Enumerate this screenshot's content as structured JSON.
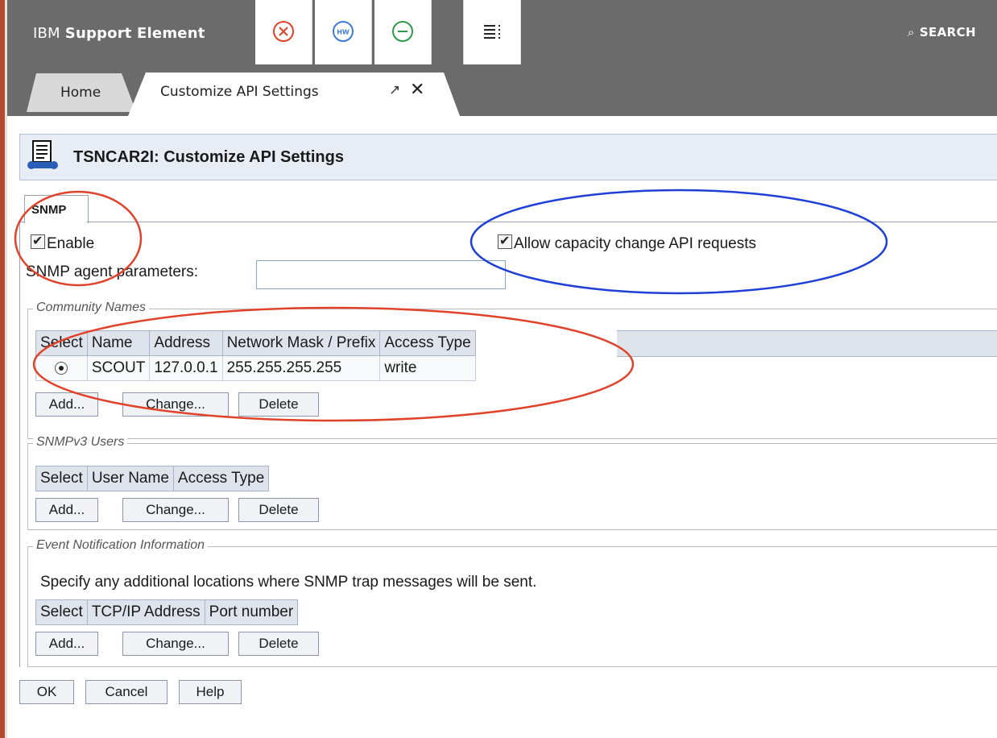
{
  "app": {
    "brand_prefix": "IBM",
    "brand_name": "Support Element",
    "search_label": "SEARCH"
  },
  "toolbar": {
    "icons": [
      "close-circle-icon",
      "hw-icon",
      "minus-circle-icon",
      "list-menu-icon"
    ],
    "hw_text": "HW"
  },
  "tabs": [
    {
      "label": "Home"
    },
    {
      "label": "Customize API Settings"
    }
  ],
  "panel": {
    "title": "TSNCAR2I: Customize API Settings",
    "subtab": "SNMP",
    "enable_label": "Enable",
    "enable_checked": true,
    "allow_capacity_label": "Allow capacity change API requests",
    "allow_capacity_checked": true,
    "agent_params_label": "SNMP agent parameters:",
    "agent_params_value": ""
  },
  "community": {
    "legend": "Community Names",
    "headers": [
      "Select",
      "Name",
      "Address",
      "Network Mask / Prefix",
      "Access Type"
    ],
    "rows": [
      {
        "name": "SCOUT",
        "address": "127.0.0.1",
        "mask": "255.255.255.255",
        "access": "write"
      }
    ]
  },
  "snmpv3": {
    "legend": "SNMPv3 Users",
    "headers": [
      "Select",
      "User Name",
      "Access Type"
    ]
  },
  "events": {
    "legend": "Event Notification Information",
    "description": "Specify any additional locations where SNMP trap messages will be sent.",
    "headers": [
      "Select",
      "TCP/IP Address",
      "Port number"
    ]
  },
  "buttons": {
    "add": "Add...",
    "change": "Change...",
    "delete": "Delete",
    "ok": "OK",
    "cancel": "Cancel",
    "help": "Help"
  },
  "colors": {
    "topbar": "#6b6b6b",
    "annotation_red": "#e0432a",
    "annotation_blue": "#1f3fd6"
  }
}
